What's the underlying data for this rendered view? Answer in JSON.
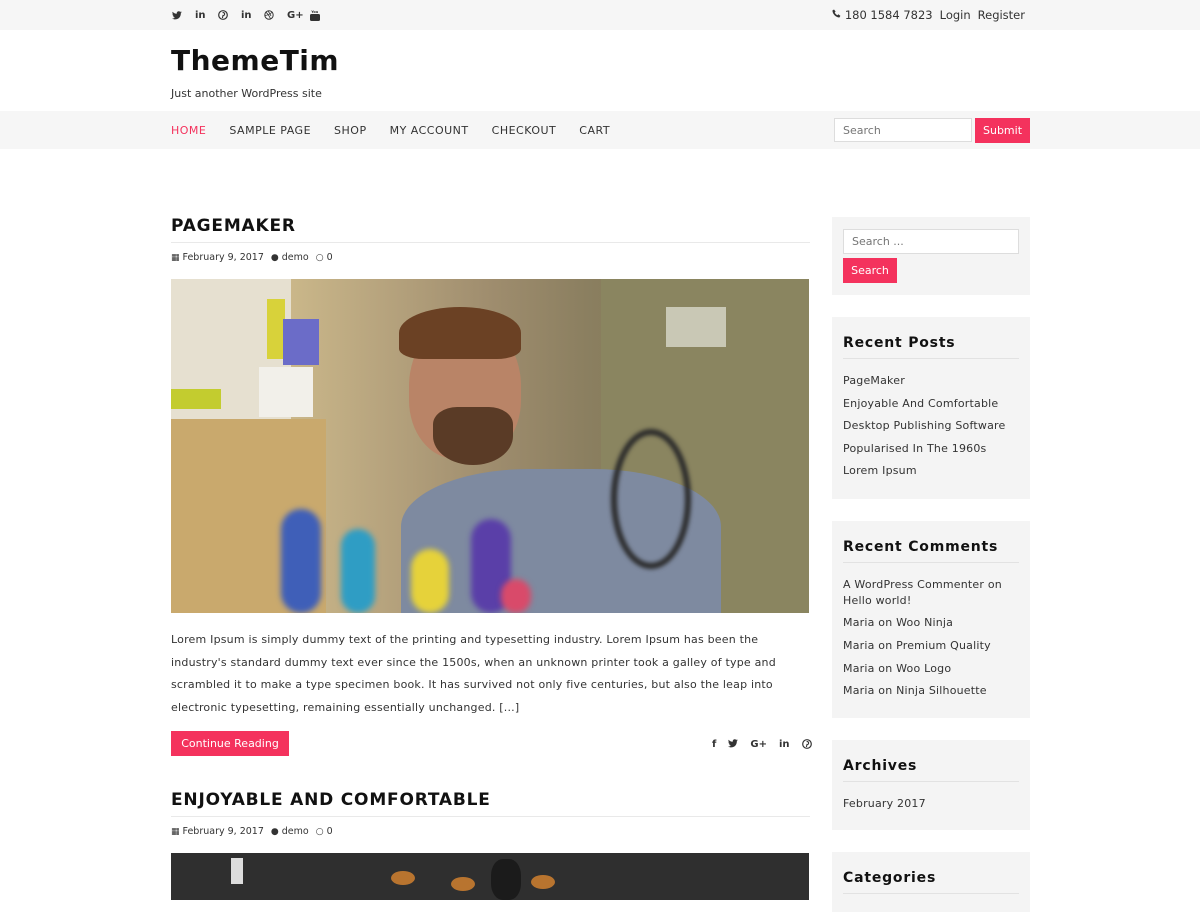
{
  "topbar": {
    "social_icons": [
      "twitter-icon",
      "linkedin-icon",
      "pinterest-icon",
      "linkedin-icon",
      "dribbble-icon",
      "google-plus-icon",
      "youtube-icon"
    ],
    "phone": "180 1584 7823",
    "login": "Login",
    "register": "Register"
  },
  "header": {
    "title": "ThemeTim",
    "tagline": "Just another WordPress site"
  },
  "nav": {
    "items": [
      "HOME",
      "SAMPLE PAGE",
      "SHOP",
      "MY ACCOUNT",
      "CHECKOUT",
      "CART"
    ],
    "active": "HOME",
    "search_placeholder": "Search",
    "submit_label": "Submit"
  },
  "posts": [
    {
      "title": "PAGEMAKER",
      "date": "February 9, 2017",
      "author": "demo",
      "comments": "0",
      "excerpt": "Lorem Ipsum is simply dummy text of the printing and typesetting industry. Lorem Ipsum has been the industry's standard dummy text ever since the 1500s, when an unknown printer took a galley of type and scrambled it to make a type specimen book. It has survived not only five centuries, but also the leap into electronic typesetting, remaining essentially unchanged. [...]",
      "continue_label": "Continue Reading"
    },
    {
      "title": "ENJOYABLE AND COMFORTABLE",
      "date": "February 9, 2017",
      "author": "demo",
      "comments": "0"
    }
  ],
  "sidebar": {
    "search": {
      "placeholder": "Search ...",
      "button": "Search"
    },
    "recent_posts": {
      "title": "Recent Posts",
      "items": [
        "PageMaker",
        "Enjoyable And Comfortable",
        "Desktop Publishing Software",
        "Popularised In The 1960s",
        "Lorem Ipsum"
      ]
    },
    "recent_comments": {
      "title": "Recent Comments",
      "items": [
        {
          "author": "A WordPress Commenter",
          "on": "on",
          "post": "Hello world!"
        },
        {
          "author": "Maria",
          "on": "on",
          "post": "Woo Ninja"
        },
        {
          "author": "Maria",
          "on": "on",
          "post": "Premium Quality"
        },
        {
          "author": "Maria",
          "on": "on",
          "post": "Woo Logo"
        },
        {
          "author": "Maria",
          "on": "on",
          "post": "Ninja Silhouette"
        }
      ]
    },
    "archives": {
      "title": "Archives",
      "items": [
        "February 2017"
      ]
    },
    "categories": {
      "title": "Categories"
    }
  },
  "share_icons": [
    "facebook-icon",
    "twitter-icon",
    "google-plus-icon",
    "linkedin-icon",
    "pinterest-icon"
  ],
  "colors": {
    "accent": "#f4325d",
    "bar": "#f6f6f6",
    "widget": "#f4f4f4"
  }
}
